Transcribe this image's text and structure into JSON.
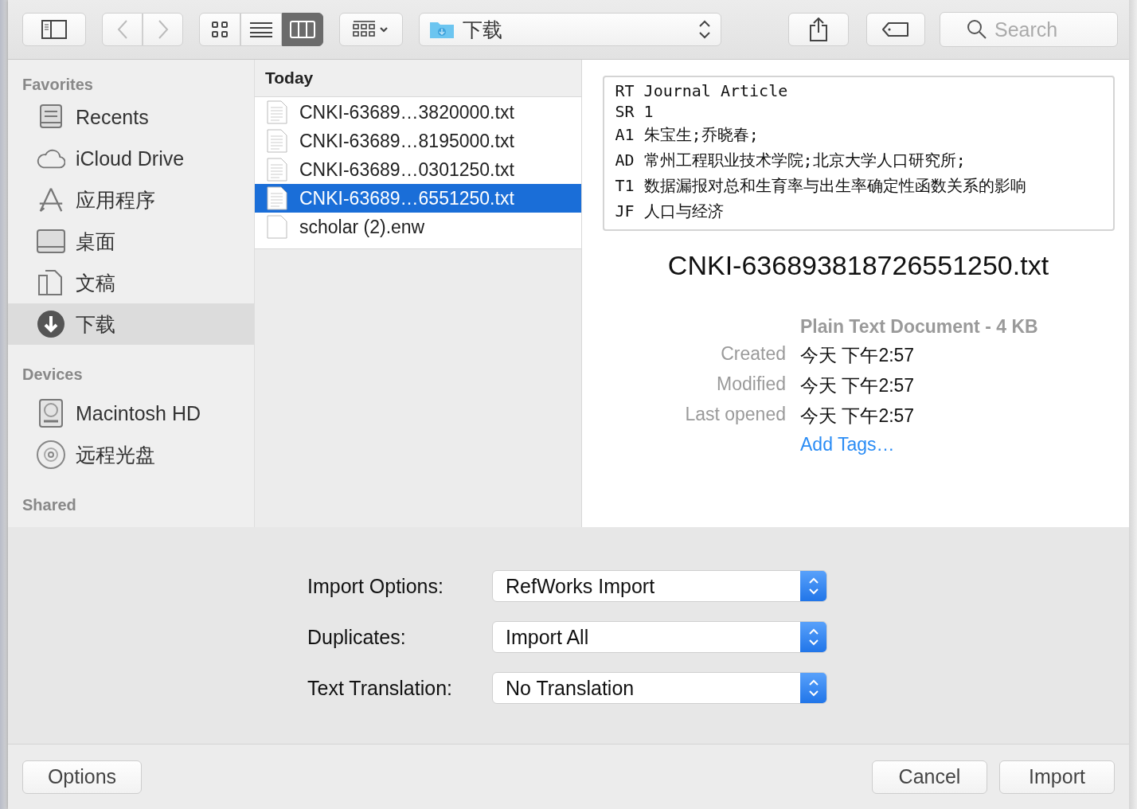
{
  "toolbar": {
    "view_modes": [
      {
        "kind": "icons",
        "selected": false
      },
      {
        "kind": "list",
        "selected": false
      },
      {
        "kind": "columns",
        "selected": true
      }
    ],
    "path": "下载",
    "search": {
      "placeholder": "Search"
    }
  },
  "sidebar": {
    "sections": [
      {
        "title": "Favorites",
        "items": [
          {
            "label": "Recents",
            "kind": "recents",
            "selected": false
          },
          {
            "label": "iCloud Drive",
            "kind": "cloud",
            "selected": false
          },
          {
            "label": "应用程序",
            "kind": "apps",
            "selected": false
          },
          {
            "label": "桌面",
            "kind": "desktop",
            "selected": false
          },
          {
            "label": "文稿",
            "kind": "documents",
            "selected": false
          },
          {
            "label": "下载",
            "kind": "downloads",
            "selected": true
          }
        ]
      },
      {
        "title": "Devices",
        "items": [
          {
            "label": "Macintosh HD",
            "kind": "disk",
            "selected": false
          },
          {
            "label": "远程光盘",
            "kind": "disc",
            "selected": false
          }
        ]
      },
      {
        "title": "Shared"
      }
    ]
  },
  "file_column": {
    "heading": "Today",
    "files": [
      {
        "name": "CNKI-63689…3820000.txt",
        "kind": "text",
        "selected": false
      },
      {
        "name": "CNKI-63689…8195000.txt",
        "kind": "text",
        "selected": false
      },
      {
        "name": "CNKI-63689…0301250.txt",
        "kind": "text",
        "selected": false
      },
      {
        "name": "CNKI-63689…6551250.txt",
        "kind": "text",
        "selected": true
      },
      {
        "name": "scholar (2).enw",
        "kind": "blank",
        "selected": false
      }
    ]
  },
  "preview": {
    "text_lines": [
      {
        "tag": "RT",
        "value": "Journal Article"
      },
      {
        "tag": "SR",
        "value": "1"
      },
      {
        "tag": "A1",
        "value": "朱宝生;乔晓春;"
      },
      {
        "tag": "AD",
        "value": "常州工程职业技术学院;北京大学人口研究所;"
      },
      {
        "tag": "T1",
        "value": "数据漏报对总和生育率与出生率确定性函数关系的影响"
      },
      {
        "tag": "JF",
        "value": "人口与经济"
      }
    ],
    "file_name": "CNKI-636893818726551250.txt",
    "kind_size": "Plain Text Document - 4 KB",
    "info": [
      {
        "label": "Created",
        "value": "今天 下午2:57"
      },
      {
        "label": "Modified",
        "value": "今天 下午2:57"
      },
      {
        "label": "Last opened",
        "value": "今天 下午2:57"
      }
    ],
    "add_tags": "Add Tags…"
  },
  "import_options": [
    {
      "label": "Import Options:",
      "value": "RefWorks Import"
    },
    {
      "label": "Duplicates:",
      "value": "Import All"
    },
    {
      "label": "Text Translation:",
      "value": "No Translation"
    }
  ],
  "buttons": {
    "options": "Options",
    "cancel": "Cancel",
    "import": "Import"
  }
}
